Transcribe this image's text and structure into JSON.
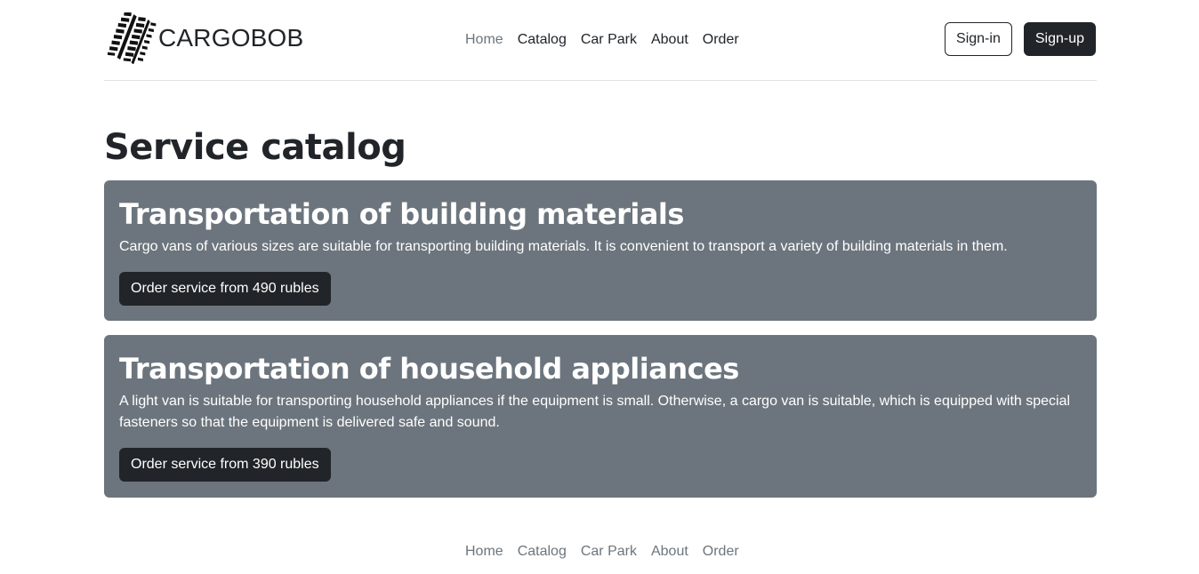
{
  "brand": {
    "name": "CARGOBOB",
    "logo_icon": "tire-tracks-icon"
  },
  "nav": [
    {
      "label": "Home",
      "active": true
    },
    {
      "label": "Catalog",
      "active": false
    },
    {
      "label": "Car Park",
      "active": false
    },
    {
      "label": "About",
      "active": false
    },
    {
      "label": "Order",
      "active": false
    }
  ],
  "auth": {
    "signin_label": "Sign-in",
    "signup_label": "Sign-up"
  },
  "main": {
    "title": "Service catalog",
    "services": [
      {
        "title": "Transportation of building materials",
        "description": "Cargo vans of various sizes are suitable for transporting building materials. It is convenient to transport a variety of building materials in them.",
        "button_label": "Order service from 490 rubles"
      },
      {
        "title": "Transportation of household appliances",
        "description": "A light van is suitable for transporting household appliances if the equipment is small. Otherwise, a cargo van is suitable, which is equipped with special fasteners so that the equipment is delivered safe and sound.",
        "button_label": "Order service from 390 rubles"
      }
    ]
  },
  "footer": {
    "nav": [
      {
        "label": "Home"
      },
      {
        "label": "Catalog"
      },
      {
        "label": "Car Park"
      },
      {
        "label": "About"
      },
      {
        "label": "Order"
      }
    ]
  },
  "colors": {
    "card_bg": "#6c757d",
    "dark": "#212529",
    "muted": "#6c757d",
    "divider": "#dee2e6"
  }
}
